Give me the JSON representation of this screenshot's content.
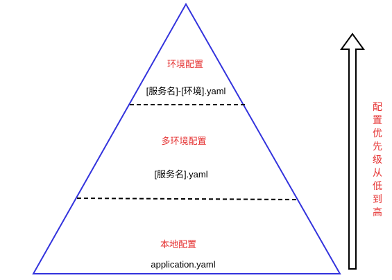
{
  "pyramid": {
    "levels": [
      {
        "title": "环境配置",
        "file": "[服务名]-[环境].yaml"
      },
      {
        "title": "多环境配置",
        "file": "[服务名].yaml"
      },
      {
        "title": "本地配置",
        "file": "application.yaml"
      }
    ]
  },
  "side_label": [
    "配",
    "置",
    "优",
    "先",
    "级",
    "从",
    "低",
    "到",
    "高"
  ],
  "colors": {
    "outline": "#3333dd",
    "accent_text": "#e53333",
    "text": "#000000",
    "divider": "#000000"
  }
}
